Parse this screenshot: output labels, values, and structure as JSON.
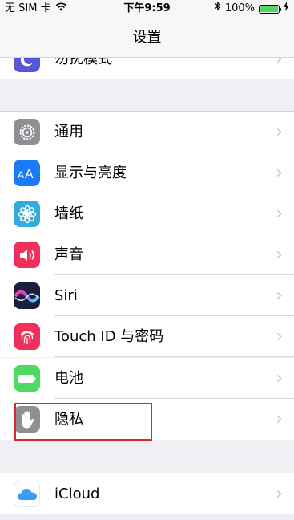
{
  "status_bar": {
    "carrier": "无 SIM 卡",
    "time": "下午9:59",
    "battery": "100%"
  },
  "nav": {
    "title": "设置"
  },
  "rows": [
    {
      "label": "勿扰模式",
      "icon": "moon-icon",
      "color": "#5856d6"
    },
    {
      "label": "通用",
      "icon": "gear-icon",
      "color": "#8e8e93"
    },
    {
      "label": "显示与亮度",
      "icon": "text-size-icon",
      "color": "#1a7cf5"
    },
    {
      "label": "墙纸",
      "icon": "flower-icon",
      "color": "#35aadc"
    },
    {
      "label": "声音",
      "icon": "speaker-icon",
      "color": "#f0305a"
    },
    {
      "label": "Siri",
      "icon": "siri-icon",
      "color": "#1b1f3a"
    },
    {
      "label": "Touch ID 与密码",
      "icon": "fingerprint-icon",
      "color": "#f0305a"
    },
    {
      "label": "电池",
      "icon": "battery-icon",
      "color": "#4cd964"
    },
    {
      "label": "隐私",
      "icon": "hand-icon",
      "color": "#8e8e93"
    },
    {
      "label": "iCloud",
      "icon": "cloud-icon",
      "color": "#ffffff"
    }
  ],
  "chevron": "›",
  "highlight": {
    "color": "#d9262d",
    "target": "隐私"
  }
}
